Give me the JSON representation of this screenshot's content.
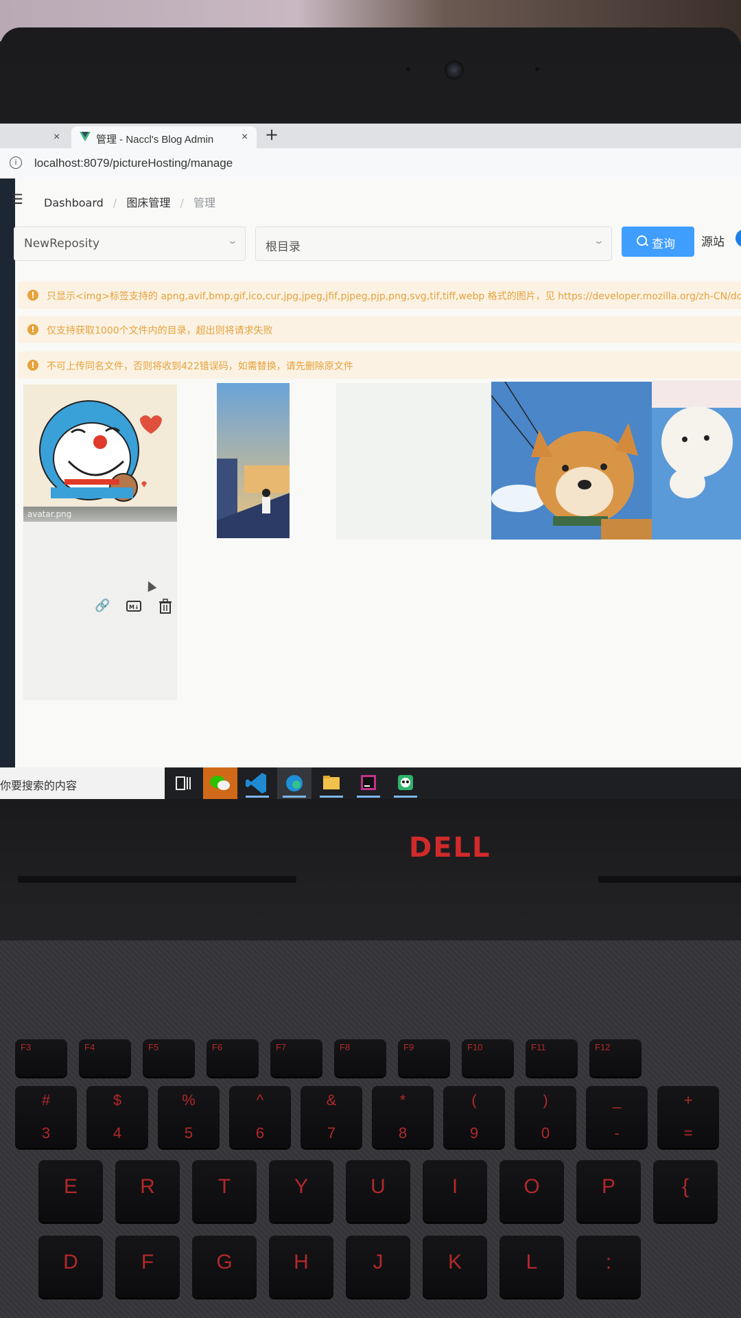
{
  "browser": {
    "tabs": [
      {
        "title": "",
        "close": "×"
      },
      {
        "title": "管理 - Naccl's Blog Admin",
        "close": "×"
      }
    ],
    "new_tab": "+",
    "url": "localhost:8079/pictureHosting/manage"
  },
  "breadcrumb": {
    "items": [
      "Dashboard",
      "图床管理",
      "管理"
    ],
    "separator": "/"
  },
  "toolbar": {
    "repo_select": "NewReposity",
    "dir_select": "根目录",
    "query_label": "查询",
    "source_label": "源站"
  },
  "alerts": [
    "只显示<img>标签支持的 apng,avif,bmp,gif,ico,cur,jpg,jpeg,jfif,pjpeg,pjp,png,svg,tif,tiff,webp 格式的图片，见 https://developer.mozilla.org/zh-CN/docs/Web",
    "仅支持获取1000个文件内的目录，超出则将请求失败",
    "不可上传同名文件，否则将收到422错误码，如需替换，请先删除原文件"
  ],
  "gallery": {
    "first_caption": "avatar.png"
  },
  "taskbar": {
    "search_text": "你要搜索的内容"
  },
  "laptop": {
    "brand": "DELL"
  },
  "keyboard": {
    "function_row": [
      "F3",
      "F4",
      "F5",
      "F6",
      "F7",
      "F8",
      "F9",
      "F10",
      "F11",
      "F12"
    ],
    "number_row": [
      {
        "top": "#",
        "bottom": "3"
      },
      {
        "top": "$",
        "bottom": "4"
      },
      {
        "top": "%",
        "bottom": "5"
      },
      {
        "top": "^",
        "bottom": "6"
      },
      {
        "top": "&",
        "bottom": "7"
      },
      {
        "top": "*",
        "bottom": "8"
      },
      {
        "top": "(",
        "bottom": "9"
      },
      {
        "top": ")",
        "bottom": "0"
      },
      {
        "top": "_",
        "bottom": "-"
      },
      {
        "top": "+",
        "bottom": "="
      }
    ],
    "letter_row1": [
      "E",
      "R",
      "T",
      "Y",
      "U",
      "I",
      "O",
      "P",
      "{"
    ],
    "letter_row2": [
      "D",
      "F",
      "G",
      "H",
      "J",
      "K",
      "L",
      ":"
    ]
  },
  "colors": {
    "primary": "#409eff",
    "warning": "#e6a23c",
    "brand_red": "#d12a2a"
  }
}
